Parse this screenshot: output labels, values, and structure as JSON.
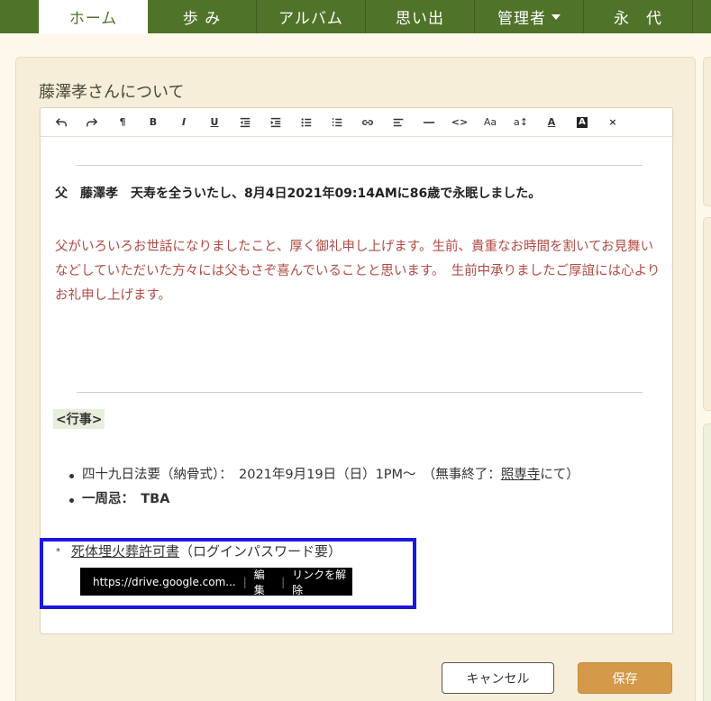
{
  "nav": {
    "items": [
      {
        "label": "ホーム"
      },
      {
        "label": "歩 み"
      },
      {
        "label": "アルバム"
      },
      {
        "label": "思い出"
      },
      {
        "label": "管理者"
      },
      {
        "label": "永　代"
      }
    ]
  },
  "panel": {
    "title": "藤澤孝さんについて"
  },
  "toolbar": {
    "bold": "B",
    "italic": "I",
    "underline": "U",
    "pilcrow": "¶",
    "code": "<>",
    "font_size": "Aa",
    "line_height": "a↕",
    "font_color": "A",
    "bg_color": "A",
    "clear": "×"
  },
  "content": {
    "line1": "父　藤澤孝　天寿を全ういたし、8月4日2021年09:14AMに86歳で永眠しました。",
    "para": "父がいろいろお世話になりましたこと、厚く御礼申し上げます。生前、貴重なお時間を割いてお見舞いなどしていただいた方々には父もさぞ喜んでいることと思います。　生前中承りましたご厚誼には心よりお礼申し上げます。",
    "gyoji": "<行事>",
    "bullet1_pre": "四十九日法要（納骨式）：　2021年9月19日（日）1PM～　（無事終了：",
    "bullet1_link": "照専寺",
    "bullet1_post": "にて）",
    "bullet2": "一周忌：　TBA",
    "link_star": "*",
    "link_text": "死体埋火葬許可書",
    "link_suffix": "（ログインパスワード要）"
  },
  "tooltip": {
    "url": "https://drive.google.com...",
    "edit": "編集",
    "unlink": "リンクを解除",
    "sep": "|"
  },
  "buttons": {
    "cancel": "キャンセル",
    "save": "保存"
  },
  "colors": {
    "nav_bg": "#4f7328",
    "panel_bg": "#f6eed8",
    "para_text": "#b24a44",
    "save_bg": "#d49a49",
    "highlight_border": "#1a17e0"
  }
}
